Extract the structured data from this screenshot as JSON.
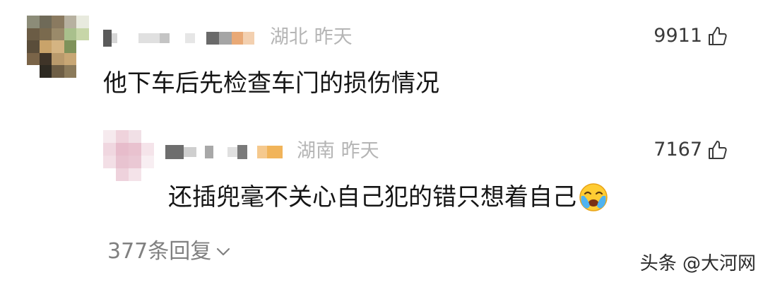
{
  "comment": {
    "location": "湖北",
    "time": "昨天",
    "likes": "9911",
    "text": "他下车后先检查车门的损伤情况"
  },
  "reply": {
    "location": "湖南",
    "time": "昨天",
    "likes": "7167",
    "text": "还插兜毫不关心自己犯的错只想着自己",
    "emoji": "crying-face-emoji"
  },
  "replies_label": "377条回复",
  "watermark": "头条 @大河网",
  "icons": {
    "like": "thumbs-up-icon",
    "expand": "chevron-down-icon"
  },
  "colors": {
    "meta_text": "#b5b5b5",
    "like_count": "#3a3a3a",
    "body_text": "#151515",
    "replies_text": "#808080"
  }
}
